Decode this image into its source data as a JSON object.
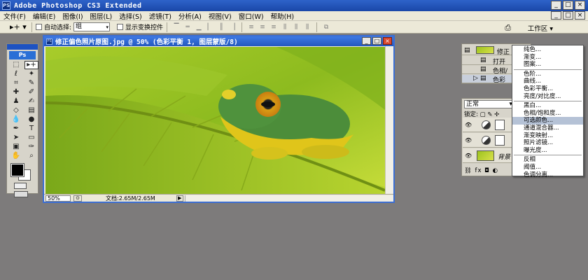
{
  "app": {
    "title": "Adobe Photoshop CS3 Extended",
    "badge": "PS"
  },
  "menubar": {
    "items": [
      "文件(F)",
      "编辑(E)",
      "图像(I)",
      "图层(L)",
      "选择(S)",
      "滤镜(T)",
      "分析(A)",
      "视图(V)",
      "窗口(W)",
      "帮助(H)"
    ]
  },
  "window_controls": {
    "minimize": "_",
    "maximize": "□",
    "close": "×"
  },
  "options_bar": {
    "tool_glyph": "▸+ ▾",
    "auto_select_label": "自动选择:",
    "auto_select_value": "组",
    "show_transform_label": "显示变换控件",
    "workspace_label": "工作区 ▾"
  },
  "tools_palette": {
    "logo": "Ps"
  },
  "document": {
    "title": "修正偏色照片原图.jpg @ 50% (色彩平衡 1, 图层蒙版/8)",
    "zoom": "50%",
    "info": "文档:2.65M/2.65M"
  },
  "layers_top": {
    "rows": [
      "修正",
      "打开",
      "色相/",
      "色彩"
    ]
  },
  "layers_panel": {
    "blend_mode": "正常",
    "lock_label": "锁定:",
    "layers": [
      {
        "name": ""
      },
      {
        "name": ""
      },
      {
        "name": "背景"
      }
    ]
  },
  "context_menu": {
    "groups": [
      [
        "纯色...",
        "渐变...",
        "图案..."
      ],
      [
        "色阶...",
        "曲线...",
        "色彩平衡...",
        "亮度/对比度..."
      ],
      [
        "黑白...",
        "色相/饱和度...",
        "可选颜色...",
        "通道混合器...",
        "渐变映射...",
        "照片滤镜...",
        "曝光度..."
      ],
      [
        "反相",
        "阈值...",
        "色调分离..."
      ]
    ],
    "highlighted": "可选颜色..."
  },
  "colors": {
    "titlebar": "#1a47a8",
    "workspace_bg": "#7d7b7b",
    "frog_green": "#4c8d3a",
    "leaf_green": "#9dc31f",
    "menu_highlight": "#b5c2d6"
  },
  "icons": [
    "ps-icon",
    "move-tool-icon",
    "marquee-icon",
    "lasso-icon",
    "crop-icon",
    "brush-icon",
    "eraser-icon",
    "pen-icon",
    "type-icon",
    "hand-icon",
    "zoom-icon",
    "eye-icon",
    "lock-icon",
    "adjustment-icon"
  ]
}
